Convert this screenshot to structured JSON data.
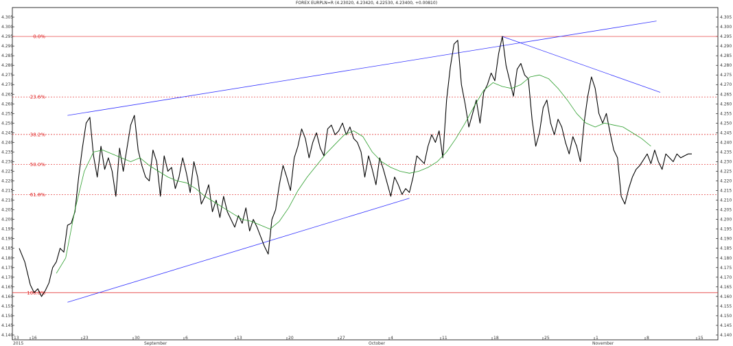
{
  "chart_data": {
    "type": "line",
    "title": "FOREX EURPLN=R (4.23020, 4.23420, 4.22530, 4.23400, +0.00810)",
    "ylim": [
      4.14,
      4.305
    ],
    "y_ticks": [
      "4.140",
      "4.145",
      "4.150",
      "4.155",
      "4.160",
      "4.165",
      "4.170",
      "4.175",
      "4.180",
      "4.185",
      "4.190",
      "4.195",
      "4.200",
      "4.205",
      "4.210",
      "4.215",
      "4.220",
      "4.225",
      "4.230",
      "4.235",
      "4.240",
      "4.245",
      "4.250",
      "4.255",
      "4.260",
      "4.265",
      "4.270",
      "4.275",
      "4.280",
      "4.285",
      "4.290",
      "4.295",
      "4.300",
      "4.305"
    ],
    "x_ticks": [
      "13",
      "16",
      "23",
      "30",
      "6",
      "13",
      "20",
      "27",
      "4",
      "11",
      "18",
      "25",
      "1",
      "8",
      "15"
    ],
    "x_tick_year": "2015",
    "month_labels": [
      "September",
      "October",
      "November"
    ],
    "series": [
      {
        "color": "#000000",
        "x": [
          0,
          3,
          6,
          8,
          10,
          12,
          14,
          16,
          18,
          20,
          22,
          24,
          26,
          28,
          30,
          32,
          34,
          36,
          38,
          40,
          42,
          44,
          46,
          48,
          50,
          52,
          54,
          56,
          58,
          60,
          62,
          64,
          66,
          68,
          70,
          72,
          74,
          76,
          78,
          80,
          82,
          84,
          86,
          88,
          90,
          92,
          94,
          96,
          98,
          100,
          102,
          104,
          106,
          108,
          110,
          112,
          114,
          116,
          118,
          120,
          122,
          124,
          126,
          128,
          130,
          132,
          134,
          136,
          138,
          140,
          142,
          144,
          146,
          148
        ],
        "y": [
          4.185,
          4.178,
          4.166,
          4.162,
          4.164,
          4.16,
          4.163,
          4.167,
          4.175,
          4.178,
          4.185,
          4.183,
          4.197,
          4.198,
          4.204,
          4.222,
          4.237,
          4.25,
          4.253,
          4.233,
          4.222,
          4.238,
          4.226,
          4.232,
          4.225,
          4.212,
          4.237,
          4.225,
          4.237,
          4.249,
          4.254,
          4.236,
          4.228,
          4.222,
          4.22,
          4.236,
          4.23,
          4.212,
          4.233,
          4.225,
          4.227,
          4.216,
          4.222,
          4.232,
          4.224,
          4.214,
          4.23,
          4.222,
          4.208,
          4.212,
          4.218,
          4.204,
          4.21,
          4.201,
          4.212,
          4.204,
          4.2,
          4.196,
          4.202,
          4.198,
          4.206,
          4.194,
          4.2,
          4.196,
          4.191,
          4.186,
          4.182,
          4.2,
          4.205,
          4.218,
          4.228,
          4.222,
          4.215,
          4.232
        ]
      },
      {
        "color": "#000000",
        "x": [
          148,
          150,
          152,
          154,
          156,
          158,
          160,
          162,
          164,
          166,
          168,
          170,
          172,
          174,
          176,
          178,
          180,
          182,
          184,
          186,
          188,
          190,
          192,
          194,
          196,
          198,
          200,
          202,
          204,
          206,
          208,
          210,
          212,
          214,
          216,
          218,
          220,
          222,
          224,
          226,
          228,
          230,
          232,
          234,
          236,
          238,
          240,
          242,
          244,
          246,
          248,
          250,
          252,
          254,
          256,
          258,
          260,
          262,
          264,
          266,
          268,
          270,
          272,
          274,
          276,
          278,
          280,
          282,
          284,
          286,
          288,
          290,
          292,
          294,
          296,
          298,
          300,
          302,
          304,
          306,
          308,
          310,
          312,
          314,
          316,
          318,
          320,
          322,
          324,
          326,
          328,
          330,
          332,
          334,
          336,
          338,
          340,
          342,
          344,
          346,
          348,
          350,
          352,
          354,
          356,
          358,
          360,
          362
        ],
        "y": [
          4.232,
          4.238,
          4.247,
          4.242,
          4.232,
          4.24,
          4.245,
          4.237,
          4.233,
          4.247,
          4.249,
          4.244,
          4.246,
          4.25,
          4.244,
          4.248,
          4.242,
          4.24,
          4.235,
          4.222,
          4.233,
          4.226,
          4.218,
          4.232,
          4.226,
          4.219,
          4.212,
          4.222,
          4.218,
          4.213,
          4.216,
          4.214,
          4.222,
          4.233,
          4.231,
          4.229,
          4.238,
          4.244,
          4.24,
          4.246,
          4.232,
          4.262,
          4.279,
          4.291,
          4.293,
          4.27,
          4.26,
          4.248,
          4.255,
          4.262,
          4.25,
          4.266,
          4.27,
          4.276,
          4.272,
          4.286,
          4.295,
          4.28,
          4.272,
          4.264,
          4.278,
          4.281,
          4.275,
          4.273,
          4.252,
          4.238,
          4.245,
          4.258,
          4.262,
          4.25,
          4.244,
          4.252,
          4.248,
          4.24,
          4.234,
          4.243,
          4.238,
          4.23,
          4.25,
          4.264,
          4.274,
          4.268,
          4.255,
          4.25,
          4.255,
          4.245,
          4.236,
          4.232,
          4.212,
          4.208,
          4.216,
          4.222,
          4.226,
          4.228,
          4.231,
          4.234,
          4.229,
          4.236,
          4.23,
          4.226,
          4.234,
          4.232,
          4.23,
          4.234,
          4.232,
          4.233,
          4.234,
          4.234
        ]
      },
      {
        "color": "#2a9d2a",
        "x": [
          20,
          25,
          30,
          35,
          40,
          45,
          50,
          55,
          60,
          65,
          70,
          75,
          80,
          85,
          90,
          95,
          100,
          105,
          110,
          115,
          120,
          125,
          130,
          135,
          140,
          145,
          150,
          155,
          160,
          165,
          170,
          175,
          180,
          185,
          190,
          195,
          200,
          205,
          210,
          215,
          220,
          225,
          230,
          235,
          240,
          245,
          250,
          255,
          260,
          265,
          270,
          275,
          280,
          285,
          290,
          295,
          300,
          305,
          310,
          315,
          320,
          325,
          330,
          335,
          340
        ],
        "y": [
          4.172,
          4.18,
          4.205,
          4.225,
          4.235,
          4.236,
          4.234,
          4.232,
          4.23,
          4.232,
          4.228,
          4.225,
          4.222,
          4.22,
          4.219,
          4.216,
          4.212,
          4.209,
          4.206,
          4.203,
          4.2,
          4.199,
          4.197,
          4.195,
          4.199,
          4.206,
          4.215,
          4.222,
          4.228,
          4.234,
          4.239,
          4.244,
          4.246,
          4.243,
          4.235,
          4.23,
          4.227,
          4.225,
          4.224,
          4.225,
          4.227,
          4.23,
          4.235,
          4.242,
          4.25,
          4.259,
          4.267,
          4.271,
          4.269,
          4.268,
          4.27,
          4.274,
          4.275,
          4.273,
          4.268,
          4.262,
          4.255,
          4.25,
          4.248,
          4.25,
          4.249,
          4.248,
          4.245,
          4.242,
          4.238
        ]
      }
    ],
    "trendlines": [
      {
        "color": "#3030ff",
        "x": [
          26,
          210
        ],
        "y": [
          4.157,
          4.211
        ]
      },
      {
        "color": "#3030ff",
        "x": [
          26,
          343
        ],
        "y": [
          4.254,
          4.303
        ]
      },
      {
        "color": "#3030ff",
        "x": [
          260,
          345
        ],
        "y": [
          4.295,
          4.266
        ]
      }
    ],
    "fibonacci": [
      {
        "label": "0.0%",
        "value": 4.295
      },
      {
        "label": "23.6%",
        "value": 4.2636
      },
      {
        "label": "38.2%",
        "value": 4.2441
      },
      {
        "label": "50.0%",
        "value": 4.2285
      },
      {
        "label": "61.8%",
        "value": 4.2129
      },
      {
        "label": "100.0%",
        "value": 4.162
      }
    ]
  }
}
